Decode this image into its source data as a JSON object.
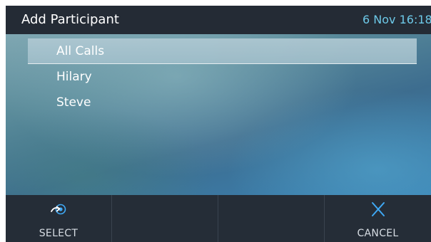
{
  "header": {
    "title": "Add Participant",
    "datetime": "6 Nov 16:18"
  },
  "list": {
    "items": [
      {
        "label": "All Calls",
        "selected": true
      },
      {
        "label": "Hilary",
        "selected": false
      },
      {
        "label": "Steve",
        "selected": false
      }
    ]
  },
  "softkeys": [
    {
      "label": "SELECT",
      "icon": "select-arrow-icon"
    },
    {
      "label": "",
      "icon": ""
    },
    {
      "label": "",
      "icon": ""
    },
    {
      "label": "CANCEL",
      "icon": "close-icon"
    }
  ],
  "colors": {
    "header_bg": "#242b35",
    "datetime": "#6dc9e8",
    "softkey_bg": "#252d37",
    "cancel_icon": "#3fa9f5",
    "select_icon": "#ffffff"
  }
}
